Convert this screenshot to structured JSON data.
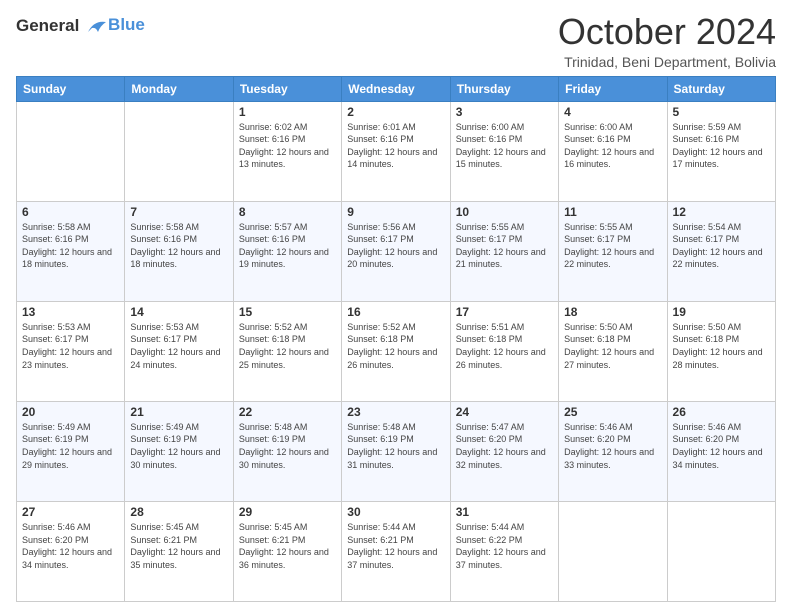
{
  "logo": {
    "line1": "General",
    "line2": "Blue"
  },
  "title": "October 2024",
  "subtitle": "Trinidad, Beni Department, Bolivia",
  "days_of_week": [
    "Sunday",
    "Monday",
    "Tuesday",
    "Wednesday",
    "Thursday",
    "Friday",
    "Saturday"
  ],
  "weeks": [
    [
      {
        "day": "",
        "sunrise": "",
        "sunset": "",
        "daylight": ""
      },
      {
        "day": "",
        "sunrise": "",
        "sunset": "",
        "daylight": ""
      },
      {
        "day": "1",
        "sunrise": "Sunrise: 6:02 AM",
        "sunset": "Sunset: 6:16 PM",
        "daylight": "Daylight: 12 hours and 13 minutes."
      },
      {
        "day": "2",
        "sunrise": "Sunrise: 6:01 AM",
        "sunset": "Sunset: 6:16 PM",
        "daylight": "Daylight: 12 hours and 14 minutes."
      },
      {
        "day": "3",
        "sunrise": "Sunrise: 6:00 AM",
        "sunset": "Sunset: 6:16 PM",
        "daylight": "Daylight: 12 hours and 15 minutes."
      },
      {
        "day": "4",
        "sunrise": "Sunrise: 6:00 AM",
        "sunset": "Sunset: 6:16 PM",
        "daylight": "Daylight: 12 hours and 16 minutes."
      },
      {
        "day": "5",
        "sunrise": "Sunrise: 5:59 AM",
        "sunset": "Sunset: 6:16 PM",
        "daylight": "Daylight: 12 hours and 17 minutes."
      }
    ],
    [
      {
        "day": "6",
        "sunrise": "Sunrise: 5:58 AM",
        "sunset": "Sunset: 6:16 PM",
        "daylight": "Daylight: 12 hours and 18 minutes."
      },
      {
        "day": "7",
        "sunrise": "Sunrise: 5:58 AM",
        "sunset": "Sunset: 6:16 PM",
        "daylight": "Daylight: 12 hours and 18 minutes."
      },
      {
        "day": "8",
        "sunrise": "Sunrise: 5:57 AM",
        "sunset": "Sunset: 6:16 PM",
        "daylight": "Daylight: 12 hours and 19 minutes."
      },
      {
        "day": "9",
        "sunrise": "Sunrise: 5:56 AM",
        "sunset": "Sunset: 6:17 PM",
        "daylight": "Daylight: 12 hours and 20 minutes."
      },
      {
        "day": "10",
        "sunrise": "Sunrise: 5:55 AM",
        "sunset": "Sunset: 6:17 PM",
        "daylight": "Daylight: 12 hours and 21 minutes."
      },
      {
        "day": "11",
        "sunrise": "Sunrise: 5:55 AM",
        "sunset": "Sunset: 6:17 PM",
        "daylight": "Daylight: 12 hours and 22 minutes."
      },
      {
        "day": "12",
        "sunrise": "Sunrise: 5:54 AM",
        "sunset": "Sunset: 6:17 PM",
        "daylight": "Daylight: 12 hours and 22 minutes."
      }
    ],
    [
      {
        "day": "13",
        "sunrise": "Sunrise: 5:53 AM",
        "sunset": "Sunset: 6:17 PM",
        "daylight": "Daylight: 12 hours and 23 minutes."
      },
      {
        "day": "14",
        "sunrise": "Sunrise: 5:53 AM",
        "sunset": "Sunset: 6:17 PM",
        "daylight": "Daylight: 12 hours and 24 minutes."
      },
      {
        "day": "15",
        "sunrise": "Sunrise: 5:52 AM",
        "sunset": "Sunset: 6:18 PM",
        "daylight": "Daylight: 12 hours and 25 minutes."
      },
      {
        "day": "16",
        "sunrise": "Sunrise: 5:52 AM",
        "sunset": "Sunset: 6:18 PM",
        "daylight": "Daylight: 12 hours and 26 minutes."
      },
      {
        "day": "17",
        "sunrise": "Sunrise: 5:51 AM",
        "sunset": "Sunset: 6:18 PM",
        "daylight": "Daylight: 12 hours and 26 minutes."
      },
      {
        "day": "18",
        "sunrise": "Sunrise: 5:50 AM",
        "sunset": "Sunset: 6:18 PM",
        "daylight": "Daylight: 12 hours and 27 minutes."
      },
      {
        "day": "19",
        "sunrise": "Sunrise: 5:50 AM",
        "sunset": "Sunset: 6:18 PM",
        "daylight": "Daylight: 12 hours and 28 minutes."
      }
    ],
    [
      {
        "day": "20",
        "sunrise": "Sunrise: 5:49 AM",
        "sunset": "Sunset: 6:19 PM",
        "daylight": "Daylight: 12 hours and 29 minutes."
      },
      {
        "day": "21",
        "sunrise": "Sunrise: 5:49 AM",
        "sunset": "Sunset: 6:19 PM",
        "daylight": "Daylight: 12 hours and 30 minutes."
      },
      {
        "day": "22",
        "sunrise": "Sunrise: 5:48 AM",
        "sunset": "Sunset: 6:19 PM",
        "daylight": "Daylight: 12 hours and 30 minutes."
      },
      {
        "day": "23",
        "sunrise": "Sunrise: 5:48 AM",
        "sunset": "Sunset: 6:19 PM",
        "daylight": "Daylight: 12 hours and 31 minutes."
      },
      {
        "day": "24",
        "sunrise": "Sunrise: 5:47 AM",
        "sunset": "Sunset: 6:20 PM",
        "daylight": "Daylight: 12 hours and 32 minutes."
      },
      {
        "day": "25",
        "sunrise": "Sunrise: 5:46 AM",
        "sunset": "Sunset: 6:20 PM",
        "daylight": "Daylight: 12 hours and 33 minutes."
      },
      {
        "day": "26",
        "sunrise": "Sunrise: 5:46 AM",
        "sunset": "Sunset: 6:20 PM",
        "daylight": "Daylight: 12 hours and 34 minutes."
      }
    ],
    [
      {
        "day": "27",
        "sunrise": "Sunrise: 5:46 AM",
        "sunset": "Sunset: 6:20 PM",
        "daylight": "Daylight: 12 hours and 34 minutes."
      },
      {
        "day": "28",
        "sunrise": "Sunrise: 5:45 AM",
        "sunset": "Sunset: 6:21 PM",
        "daylight": "Daylight: 12 hours and 35 minutes."
      },
      {
        "day": "29",
        "sunrise": "Sunrise: 5:45 AM",
        "sunset": "Sunset: 6:21 PM",
        "daylight": "Daylight: 12 hours and 36 minutes."
      },
      {
        "day": "30",
        "sunrise": "Sunrise: 5:44 AM",
        "sunset": "Sunset: 6:21 PM",
        "daylight": "Daylight: 12 hours and 37 minutes."
      },
      {
        "day": "31",
        "sunrise": "Sunrise: 5:44 AM",
        "sunset": "Sunset: 6:22 PM",
        "daylight": "Daylight: 12 hours and 37 minutes."
      },
      {
        "day": "",
        "sunrise": "",
        "sunset": "",
        "daylight": ""
      },
      {
        "day": "",
        "sunrise": "",
        "sunset": "",
        "daylight": ""
      }
    ]
  ]
}
